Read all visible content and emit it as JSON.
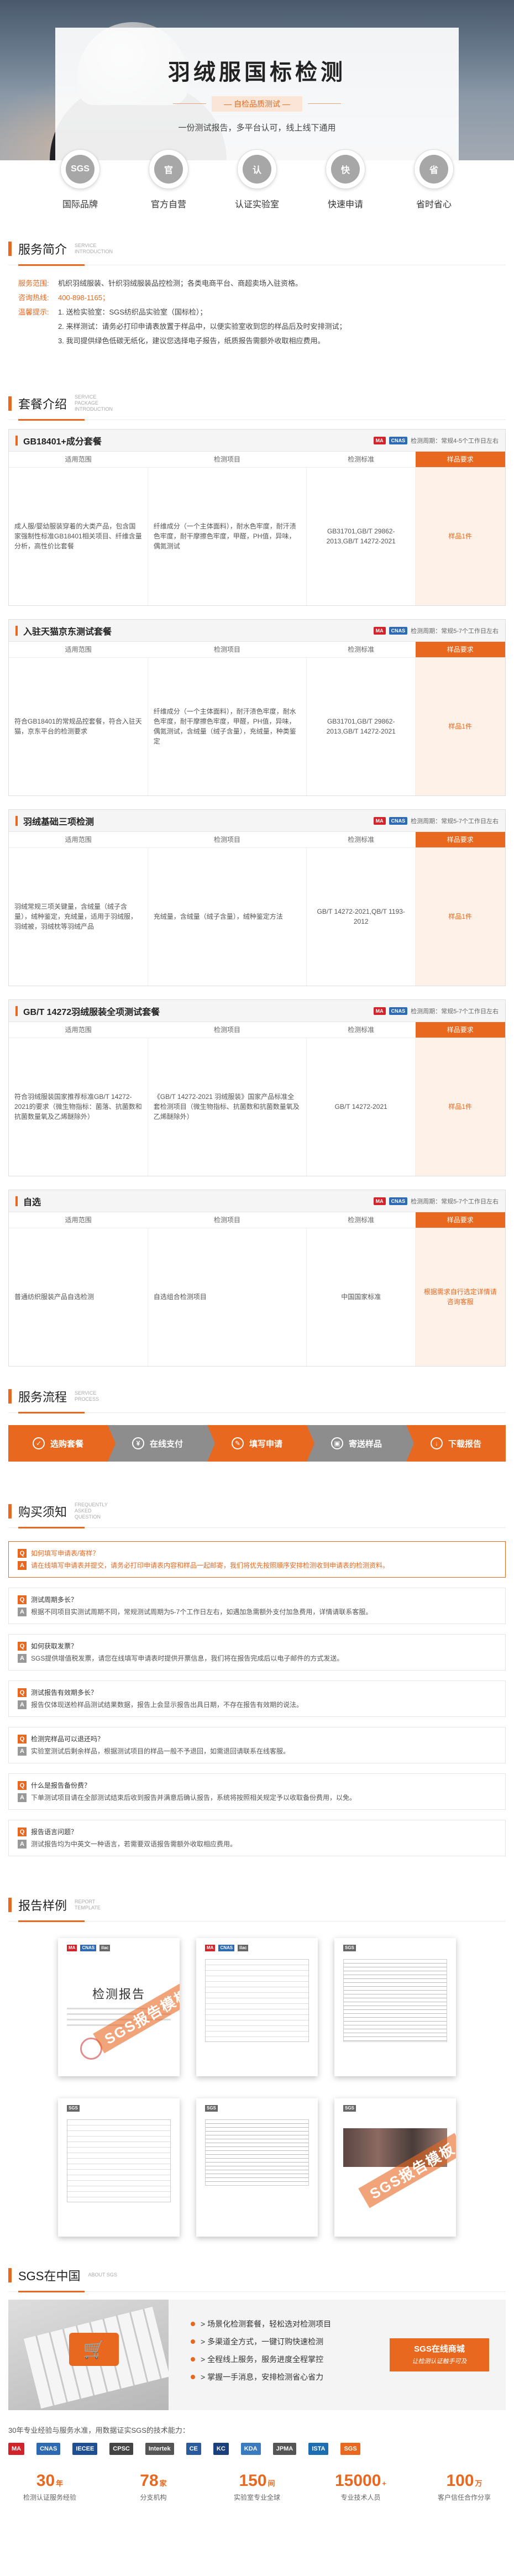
{
  "hero": {
    "title": "羽绒服国标检测",
    "tag": "— 自检品质测试 —",
    "subtitle": "一份测试报告，多平台认可，线上线下通用",
    "features": [
      {
        "icon": "SGS",
        "label": "国际品牌"
      },
      {
        "icon": "官",
        "label": "官方自营"
      },
      {
        "icon": "认",
        "label": "认证实验室"
      },
      {
        "icon": "快",
        "label": "快速申请"
      },
      {
        "icon": "省",
        "label": "省时省心"
      }
    ]
  },
  "intro": {
    "cn": "服务简介",
    "en": "SERVICE INTRODUCTION",
    "scope_k": "服务范围:",
    "scope_v": "机织羽绒服装、针织羽绒服装品控检测；各类电商平台、商超卖场入驻资格。",
    "hotline_k": "咨询热线:",
    "hotline_v": "400-898-1165；",
    "tip_k": "温馨提示:",
    "tips": [
      "1. 送检实验室：SGS纺织品实验室（国标检）；",
      "2. 来样测试：请务必打印申请表放置于样品中，以便实验室收到您的样品后及时安排测试；",
      "3. 我司提供绿色低碳无纸化，建议您选择电子报告，纸质报告需额外收取相应费用。"
    ]
  },
  "packages": {
    "cn": "套餐介绍",
    "en": "SERVICE PACKAGE INTRODUCTION",
    "cols": [
      "适用范围",
      "检测项目",
      "检测标准",
      "样品要求"
    ],
    "items": [
      {
        "name": "GB18401+成分套餐",
        "cycle": "检测周期：常规4-5个工作日左右",
        "scope": "成人服/婴幼服装穿着的大类产品，包含国家强制性标准GB18401相关项目、纤维含量分析，高性价比套餐",
        "items": "纤维成分（一个主体面料），耐水色牢度，耐汗渍色牢度，耐干摩擦色牢度，甲醛，PH值，异味，偶氮测试",
        "std": "GB31701,GB/T 29862-2013,GB/T 14272-2021",
        "req": "样品1件"
      },
      {
        "name": "入驻天猫京东测试套餐",
        "cycle": "检测周期：常规5-7个工作日左右",
        "scope": "符合GB18401的常规品控套餐，符合入驻天猫，京东平台的检测要求",
        "items": "纤维成分（一个主体面料），耐汗渍色牢度，耐水色牢度，耐干摩擦色牢度，甲醛，PH值，异味，偶氮测试，含绒量（绒子含量），充绒量，种类鉴定",
        "std": "GB31701,GB/T 29862-2013,GB/T 14272-2021",
        "req": "样品1件"
      },
      {
        "name": "羽绒基础三项检测",
        "cycle": "检测周期：常规5-7个工作日左右",
        "scope": "羽绒常规三项关键量，含绒量（绒子含量），绒种鉴定，充绒量，适用于羽绒服，羽绒被，羽绒枕等羽绒产品",
        "items": "充绒量，含绒量（绒子含量），绒种鉴定方法",
        "std": "GB/T 14272-2021,QB/T 1193-2012",
        "req": "样品1件"
      },
      {
        "name": "GB/T 14272羽绒服装全项测试套餐",
        "cycle": "检测周期：常规5-7个工作日左右",
        "scope": "符合羽绒服装国家推荐标准GB/T 14272-2021的要求（微生物指标：菌落、抗菌数和抗菌数量氧及乙烯醚除外）",
        "items": "《GB/T 14272-2021 羽绒服装》国家产品标准全套检测项目（微生物指标、抗菌数和抗菌数量氧及乙烯醚除外）",
        "std": "GB/T 14272-2021",
        "req": "样品1件"
      },
      {
        "name": "自选",
        "cycle": "检测周期：常规5-7个工作日左右",
        "scope": "普通纺织服装产品自选检测",
        "items": "自选组合检测项目",
        "std": "中国国家标准",
        "req": "根据需求自行选定详情请咨询客服"
      }
    ]
  },
  "flow": {
    "cn": "服务流程",
    "en": "SERVICE PROCESS",
    "steps": [
      "选购套餐",
      "在线支付",
      "填写申请",
      "寄送样品",
      "下载报告"
    ]
  },
  "faq": {
    "cn": "购买须知",
    "en": "FREQUENTLY ASKED QUESTION",
    "items": [
      {
        "q": "如何填写申请表/寄样？",
        "a": "请在线填写申请表并提交，请务必打印申请表内容和样品一起邮寄，我们将优先按照顺序安排检测收到申请表的检测资料。"
      },
      {
        "q": "测试周期多长？",
        "a": "根据不同项目实测试周期不同，常规测试周期为5-7个工作日左右，如遇加急需额外支付加急费用，详情请联系客服。"
      },
      {
        "q": "如何获取发票？",
        "a": "SGS提供增值税发票，请您在线填写申请表时提供开票信息，我们将在报告完成后以电子邮件的方式发送。"
      },
      {
        "q": "测试报告有效期多长？",
        "a": "报告仅体现送检样品测试结果数据，报告上会显示报告出具日期，不存在报告有效期的说法。"
      },
      {
        "q": "检测完样品可以退还吗？",
        "a": "实验室测试后剩余样品，根据测试项目的样品一般不予退回，如需退回请联系在线客服。"
      },
      {
        "q": "什么是报告备份费？",
        "a": "下单测试项目请在全部测试结束后收到报告并满意后确认报告，系统将按照相关规定予以收取备份费用，以免。"
      },
      {
        "q": "报告语言问题？",
        "a": "测试报告均为中英文一种语言，若需要双语报告需额外收取相应费用。"
      }
    ]
  },
  "reports": {
    "cn": "报告样例",
    "en": "REPORT TEMPLATE",
    "doc_title": "检测报告",
    "watermark": "SGS报告模板"
  },
  "china": {
    "cn": "SGS在中国",
    "en": "ABOUT SGS",
    "points": [
      "> 场景化检测套餐，轻松选对检测项目",
      "> 多渠道全方式，一键订购快速检测",
      "> 全程线上服务，服务进度全程掌控",
      "> 掌握一手消息，安排检测省心省力"
    ],
    "online_a": "SGS在线商城",
    "online_b": "让检测认证触手可及",
    "cert_intro": "30年专业经验与服务水准，用数据证实SGS的技术能力：",
    "certs": [
      {
        "name": "MA",
        "color": "#d2232a"
      },
      {
        "name": "CNAS",
        "color": "#2d6ab3"
      },
      {
        "name": "IECEE",
        "color": "#1e4f93"
      },
      {
        "name": "CPSC",
        "color": "#444444"
      },
      {
        "name": "Intertek",
        "color": "#555555"
      },
      {
        "name": "CE",
        "color": "#2a5b9c"
      },
      {
        "name": "KC",
        "color": "#1a3f7a"
      },
      {
        "name": "KDA",
        "color": "#3a7bc0"
      },
      {
        "name": "JPMA",
        "color": "#555555"
      },
      {
        "name": "ISTA",
        "color": "#1d6db2"
      },
      {
        "name": "SGS",
        "color": "#e8681f"
      }
    ],
    "stats": [
      {
        "n": "30",
        "u": "年",
        "l": "检测认证服务经验"
      },
      {
        "n": "78",
        "u": "家",
        "l": "分支机构"
      },
      {
        "n": "150",
        "u": "间",
        "l": "实验室专业全球"
      },
      {
        "n": "15000",
        "u": "+",
        "l": "专业技术人员"
      },
      {
        "n": "100",
        "u": "万",
        "l": "客户信任合作分享"
      }
    ]
  }
}
